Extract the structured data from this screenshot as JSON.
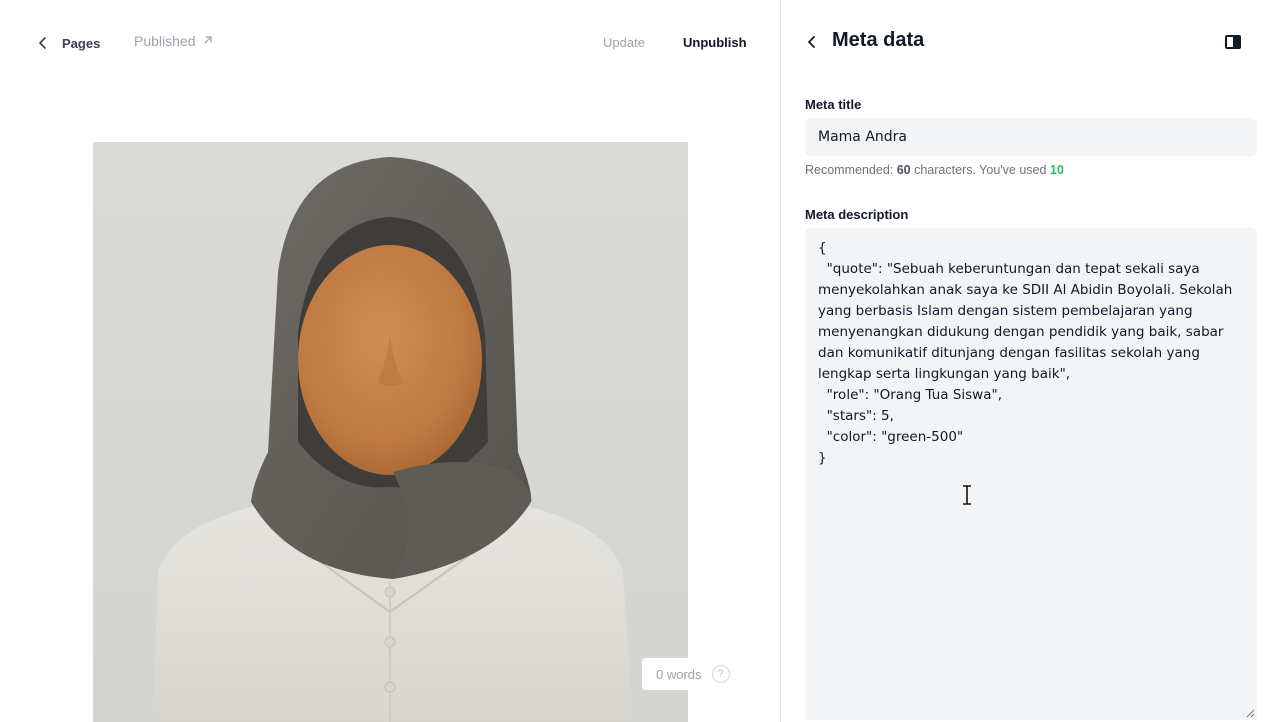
{
  "editor": {
    "back_label": "Pages",
    "status_label": "Published",
    "update_label": "Update",
    "unpublish_label": "Unpublish",
    "word_count": "0 words",
    "help_glyph": "?"
  },
  "sidebar": {
    "title": "Meta data",
    "meta_title_label": "Meta title",
    "meta_title_value": "Mama Andra",
    "hint_prefix": "Recommended: ",
    "hint_recommended": "60",
    "hint_middle": " characters. You've used ",
    "hint_used": "10",
    "meta_description_label": "Meta description",
    "meta_description_value": "{\n  \"quote\": \"Sebuah keberuntungan dan tepat sekali saya menyekolahkan anak saya ke SDII Al Abidin Boyolali. Sekolah yang berbasis Islam dengan sistem pembelajaran yang menyenangkan didukung dengan pendidik yang baik, sabar dan komunikatif ditunjang dengan fasilitas sekolah yang lengkap serta lingkungan yang baik\",\n  \"role\": \"Orang Tua Siswa\",\n  \"stars\": 5,\n  \"color\": \"green-500\"\n}"
  },
  "icons": {
    "back": "chevron-left-icon",
    "external": "arrow-up-right-icon",
    "panel": "sidebar-toggle-icon",
    "help": "question-circle-icon"
  },
  "colors": {
    "accent_used": "#22c55e",
    "muted": "#9ca3af",
    "input_bg": "#f3f4f6"
  }
}
